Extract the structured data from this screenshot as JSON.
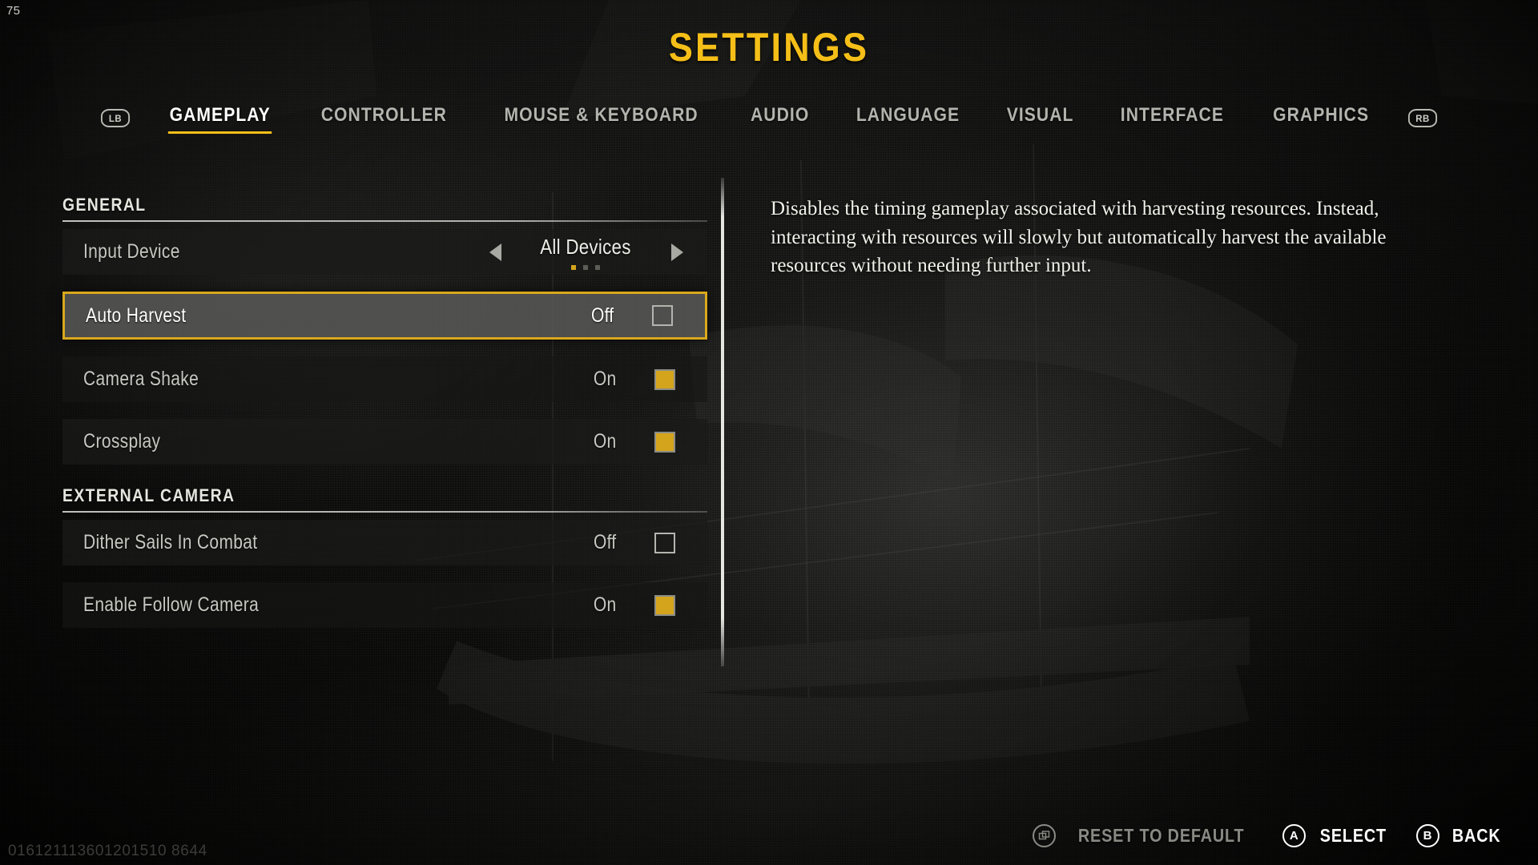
{
  "hud": {
    "fps": "75",
    "build_id": "016121113601201510 8644"
  },
  "header": {
    "title": "SETTINGS"
  },
  "tabs": {
    "left_bumper": "LB",
    "right_bumper": "RB",
    "items": [
      {
        "label": "GAMEPLAY",
        "active": true
      },
      {
        "label": "CONTROLLER",
        "active": false
      },
      {
        "label": "MOUSE & KEYBOARD",
        "active": false
      },
      {
        "label": "AUDIO",
        "active": false
      },
      {
        "label": "LANGUAGE",
        "active": false
      },
      {
        "label": "VISUAL",
        "active": false
      },
      {
        "label": "INTERFACE",
        "active": false
      },
      {
        "label": "GRAPHICS",
        "active": false
      }
    ]
  },
  "sections": [
    {
      "header": "GENERAL",
      "rows": [
        {
          "label": "Input Device",
          "control": "carousel",
          "value": "All Devices",
          "dots": 3,
          "dot_active": 0,
          "left_arrow": "◀",
          "right_arrow": "▶",
          "selected": false
        },
        {
          "label": "Auto Harvest",
          "control": "toggle",
          "value": "Off",
          "checked": false,
          "selected": true
        },
        {
          "label": "Camera Shake",
          "control": "toggle",
          "value": "On",
          "checked": true,
          "selected": false
        },
        {
          "label": "Crossplay",
          "control": "toggle",
          "value": "On",
          "checked": true,
          "selected": false
        }
      ]
    },
    {
      "header": "EXTERNAL CAMERA",
      "rows": [
        {
          "label": "Dither Sails In Combat",
          "control": "toggle",
          "value": "Off",
          "checked": false,
          "selected": false
        },
        {
          "label": "Enable Follow Camera",
          "control": "toggle",
          "value": "On",
          "checked": true,
          "selected": false
        }
      ]
    }
  ],
  "description": {
    "text": "Disables the timing gameplay associated with harvesting resources. Instead, interacting with resources will slowly but automatically harvest the available resources without needing further input."
  },
  "footer": {
    "hints": [
      {
        "button": "❐",
        "label": "RESET TO DEFAULT",
        "dim": true,
        "icon": "windows-button-icon"
      },
      {
        "button": "A",
        "label": "SELECT",
        "dim": false,
        "icon": "a-button-icon"
      },
      {
        "button": "B",
        "label": "BACK",
        "dim": false,
        "icon": "b-button-icon"
      }
    ]
  },
  "colors": {
    "accent_gold": "#f5bf18",
    "checkbox_gold": "#d4a41c",
    "selected_border": "#d9a81c",
    "text_primary": "#eeeee8",
    "text_muted": "#8a8a85"
  }
}
